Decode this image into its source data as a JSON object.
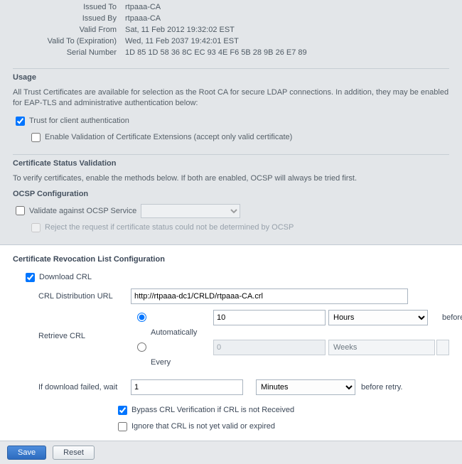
{
  "cert": {
    "issued_to_label": "Issued To",
    "issued_to": "rtpaaa-CA",
    "issued_by_label": "Issued By",
    "issued_by": "rtpaaa-CA",
    "valid_from_label": "Valid From",
    "valid_from": "Sat, 11 Feb 2012 19:32:02 EST",
    "valid_to_label": "Valid To (Expiration)",
    "valid_to": "Wed, 11 Feb 2037 19:42:01 EST",
    "serial_label": "Serial Number",
    "serial": "1D 85 1D 58 36 8C EC 93 4E F6 5B 28 9B 26 E7 89"
  },
  "usage": {
    "title": "Usage",
    "description": "All Trust Certificates are available for selection as the Root CA for secure LDAP connections. In addition, they may be enabled for EAP-TLS and administrative authentication below:",
    "trust_label": "Trust for client authentication",
    "enable_ext_label": "Enable Validation of Certificate Extensions (accept only valid certificate)"
  },
  "csv": {
    "title": "Certificate Status Validation",
    "description": "To verify certificates, enable the methods below. If both are enabled, OCSP will always be tried first.",
    "ocsp_title": "OCSP Configuration",
    "validate_label": "Validate against OCSP Service",
    "reject_label": "Reject the request if certificate status could not be determined by OCSP"
  },
  "crl": {
    "title": "Certificate Revocation List Configuration",
    "download_label": "Download CRL",
    "dist_label": "CRL Distribution URL",
    "dist_value": "http://rtpaaa-dc1/CRLD/rtpaaa-CA.crl",
    "retrieve_label": "Retrieve CRL",
    "auto_label": "Automatically",
    "auto_value": "10",
    "auto_unit_selected": "Hours",
    "auto_after": "before expiration.",
    "every_label": "Every",
    "every_value": "0",
    "every_unit": "Weeks",
    "fail_label": "If download failed, wait",
    "fail_value": "1",
    "fail_unit_selected": "Minutes",
    "fail_after": "before retry.",
    "bypass_label": "Bypass CRL Verification if CRL is not Received",
    "ignore_label": "Ignore that CRL is not yet valid or expired"
  },
  "footer": {
    "save": "Save",
    "reset": "Reset"
  }
}
